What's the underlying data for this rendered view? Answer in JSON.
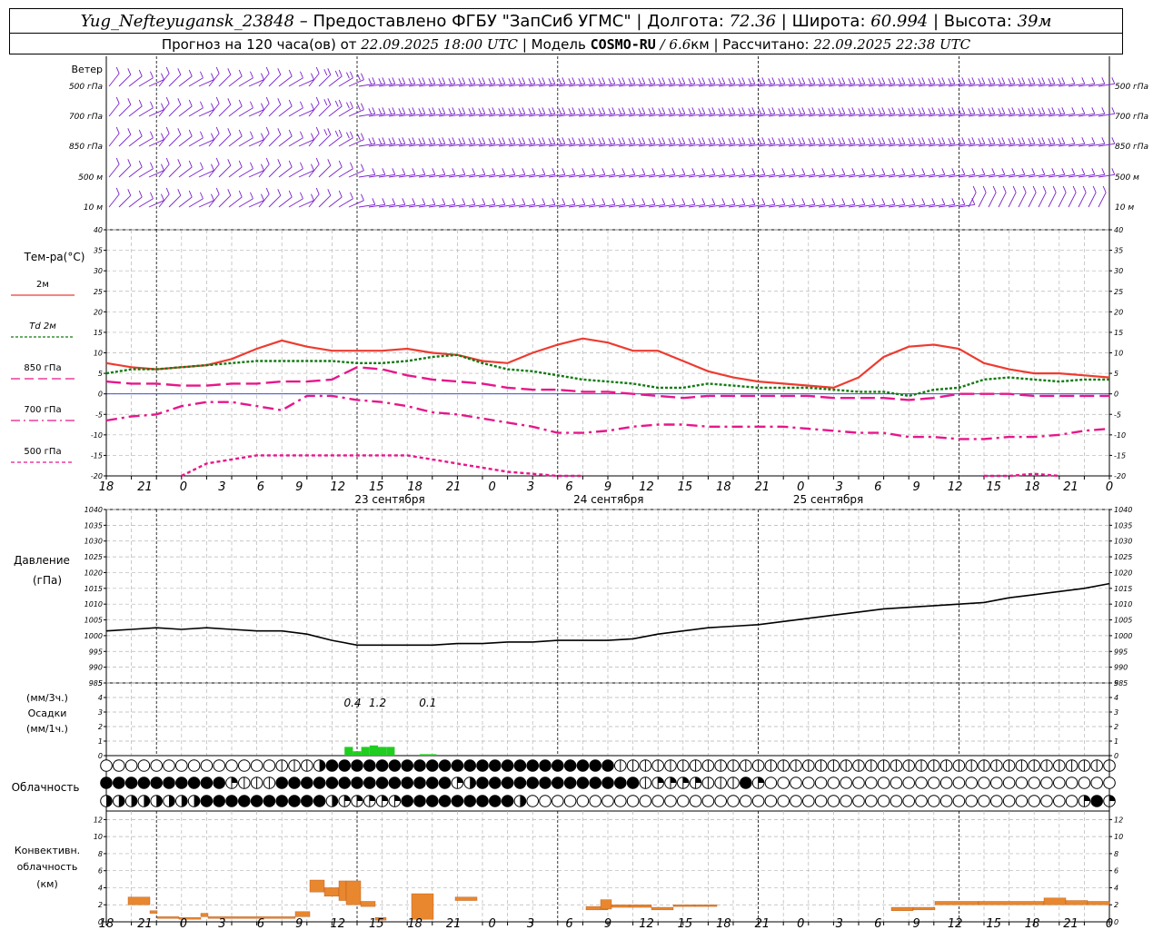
{
  "header": {
    "station": "Yug_Nefteyugansk_23848",
    "provider": "– Предоставлено ФГБУ \"ЗапСиб УГМС\"",
    "lon_label": "Долгота:",
    "lon": "72.36",
    "lat_label": "Широта:",
    "lat": "60.994",
    "alt_label": "Высота:",
    "alt": "39м",
    "forecast_label": "Прогноз на 120 часа(ов) от",
    "forecast_time": "22.09.2025 18:00 UTC",
    "model_label": "Модель",
    "model": "COSMO-RU",
    "resolution": "/ 6.6",
    "resolution_unit": "км",
    "calc_label": "Рассчитано:",
    "calc_time": "22.09.2025 22:38 UTC"
  },
  "labels": {
    "wind_title": "Ветер",
    "wind_levels": [
      "500 гПа",
      "700 гПа",
      "850 гПа",
      "500 м",
      "10  м"
    ],
    "temp_title": "Тем-ра(°C)",
    "temp_legend": [
      "2м",
      "Td  2м",
      "850 гПа",
      "700 гПа",
      "500 гПа"
    ],
    "pressure_title": "Давление",
    "pressure_unit": "(гПа)",
    "precip_unit1": "(мм/3ч.)",
    "precip_title": "Осадки",
    "precip_unit2": "(мм/1ч.)",
    "cloud_title": "Облачность",
    "conv_title1": "Конвективн.",
    "conv_title2": "облачность",
    "conv_unit": "(км)",
    "dates": [
      "23 сентября",
      "24 сентября",
      "25 сентября"
    ]
  },
  "colors": {
    "t2m": "#ee3b30",
    "td2m": "#127a12",
    "t850": "#e6178a",
    "t700": "#e6178a",
    "t500": "#e6178a",
    "wind": "#7a1fcc",
    "pressure": "#000000",
    "precip": "#22cc22",
    "conv": "#e8872e",
    "zero_line": "#2233cc"
  },
  "chart_data": {
    "type": "line",
    "x_hours": [
      0,
      120
    ],
    "x_tick_labels": [
      "18",
      "21",
      "0",
      "3",
      "6",
      "9",
      "12",
      "15",
      "18",
      "21",
      "0",
      "3",
      "6",
      "9",
      "12",
      "15",
      "18",
      "21",
      "0",
      "3",
      "6",
      "9",
      "12",
      "15",
      "18",
      "21",
      "0"
    ],
    "temperature": {
      "ylim": [
        -20,
        40
      ],
      "yticks": [
        -20,
        -15,
        -10,
        -5,
        0,
        5,
        10,
        15,
        20,
        25,
        30,
        35,
        40
      ],
      "series": [
        {
          "name": "2м",
          "key": "t2m",
          "style": "solid",
          "x": [
            0,
            3,
            6,
            9,
            12,
            15,
            18,
            21,
            24,
            27,
            30,
            33,
            36,
            39,
            42,
            45,
            48,
            51,
            54,
            57,
            60,
            63,
            66,
            69,
            72,
            75,
            78,
            81,
            84,
            87,
            90,
            93,
            96,
            99,
            102,
            105,
            108,
            111,
            114,
            117,
            120
          ],
          "y": [
            7.5,
            6.5,
            6,
            6.5,
            7,
            8.5,
            11,
            13,
            11.5,
            10.5,
            10.5,
            10.5,
            11,
            10,
            9.5,
            8,
            7.5,
            10,
            12,
            13.5,
            12.5,
            10.5,
            10.5,
            8,
            5.5,
            4,
            3,
            2.5,
            2,
            1.5,
            4,
            9,
            11.5,
            12,
            11,
            7.5,
            6,
            5,
            5,
            4.5,
            4
          ]
        },
        {
          "name": "Td  2м",
          "key": "td2m",
          "style": "dotted",
          "x": [
            0,
            3,
            6,
            9,
            12,
            15,
            18,
            21,
            24,
            27,
            30,
            33,
            36,
            39,
            42,
            45,
            48,
            51,
            54,
            57,
            60,
            63,
            66,
            69,
            72,
            75,
            78,
            81,
            84,
            87,
            90,
            93,
            96,
            99,
            102,
            105,
            108,
            111,
            114,
            117,
            120
          ],
          "y": [
            5,
            6,
            6,
            6.5,
            7,
            7.5,
            8,
            8,
            8,
            8,
            7.5,
            7.5,
            8,
            9,
            9.5,
            7.5,
            6,
            5.5,
            4.5,
            3.5,
            3,
            2.5,
            1.5,
            1.5,
            2.5,
            2,
            1.5,
            1.5,
            1.5,
            1,
            0.5,
            0.5,
            -0.5,
            1,
            1.5,
            3.5,
            4,
            3.5,
            3,
            3.5,
            3.5
          ]
        },
        {
          "name": "850 гПа",
          "key": "t850",
          "style": "longdash",
          "x": [
            0,
            3,
            6,
            9,
            12,
            15,
            18,
            21,
            24,
            27,
            30,
            33,
            36,
            39,
            42,
            45,
            48,
            51,
            54,
            57,
            60,
            63,
            66,
            69,
            72,
            75,
            78,
            81,
            84,
            87,
            90,
            93,
            96,
            99,
            102,
            105,
            108,
            111,
            114,
            117,
            120
          ],
          "y": [
            3,
            2.5,
            2.5,
            2,
            2,
            2.5,
            2.5,
            3,
            3,
            3.5,
            6.5,
            6,
            4.5,
            3.5,
            3,
            2.5,
            1.5,
            1,
            1,
            0.5,
            0.5,
            0,
            -0.5,
            -1,
            -0.5,
            -0.5,
            -0.5,
            -0.5,
            -0.5,
            -1,
            -1,
            -1,
            -1.5,
            -1,
            0,
            0,
            0,
            -0.5,
            -0.5,
            -0.5,
            -0.5
          ]
        },
        {
          "name": "700 гПа",
          "key": "t700",
          "style": "dashdot",
          "x": [
            0,
            3,
            6,
            9,
            12,
            15,
            18,
            21,
            24,
            27,
            30,
            33,
            36,
            39,
            42,
            45,
            48,
            51,
            54,
            57,
            60,
            63,
            66,
            69,
            72,
            75,
            78,
            81,
            84,
            87,
            90,
            93,
            96,
            99,
            102,
            105,
            108,
            111,
            114,
            117,
            120
          ],
          "y": [
            -6.5,
            -5.5,
            -5,
            -3,
            -2,
            -2,
            -3,
            -4,
            -0.5,
            -0.5,
            -1.5,
            -2,
            -3,
            -4.5,
            -5,
            -6,
            -7,
            -8,
            -9.5,
            -9.5,
            -9,
            -8,
            -7.5,
            -7.5,
            -8,
            -8,
            -8,
            -8,
            -8.5,
            -9,
            -9.5,
            -9.5,
            -10.5,
            -10.5,
            -11,
            -11,
            -10.5,
            -10.5,
            -10,
            -9,
            -8.5
          ]
        },
        {
          "name": "500 гПа",
          "key": "t500",
          "style": "shortdash",
          "x": [
            9,
            12,
            15,
            18,
            21,
            24,
            27,
            30,
            33,
            36,
            39,
            42,
            45,
            48,
            51,
            54,
            57
          ],
          "y": [
            -20,
            -17,
            -16,
            -15,
            -15,
            -15,
            -15,
            -15,
            -15,
            -15,
            -16,
            -17,
            -18,
            -19,
            -19.5,
            -20,
            -20
          ]
        },
        {
          "name": "500 гПа",
          "key": "t500",
          "style": "shortdash",
          "x": [
            105,
            108,
            111,
            114
          ],
          "y": [
            -20,
            -20,
            -19.5,
            -20
          ]
        }
      ]
    },
    "pressure": {
      "ylim": [
        985,
        1040
      ],
      "yticks": [
        985,
        990,
        995,
        1000,
        1005,
        1010,
        1015,
        1020,
        1025,
        1030,
        1035,
        1040
      ],
      "x": [
        0,
        3,
        6,
        9,
        12,
        15,
        18,
        21,
        24,
        27,
        30,
        33,
        36,
        39,
        42,
        45,
        48,
        51,
        54,
        57,
        60,
        63,
        66,
        69,
        72,
        75,
        78,
        81,
        84,
        87,
        90,
        93,
        96,
        99,
        102,
        105,
        108,
        111,
        114,
        117,
        120
      ],
      "y": [
        1001.5,
        1002,
        1002.5,
        1002,
        1002.5,
        1002,
        1001.5,
        1001.5,
        1000.5,
        998.5,
        997,
        997,
        997,
        997,
        997.5,
        997.5,
        998,
        998,
        998.5,
        998.5,
        998.5,
        999,
        1000.5,
        1001.5,
        1002.5,
        1003,
        1003.5,
        1004.5,
        1005.5,
        1006.5,
        1007.5,
        1008.5,
        1009,
        1009.5,
        1010,
        1010.5,
        1012,
        1013,
        1014,
        1015,
        1016.5
      ]
    },
    "precip": {
      "ylim": [
        0,
        5
      ],
      "yticks": [
        0,
        1,
        2,
        3,
        4,
        5
      ],
      "bars": [
        {
          "x": 28.5,
          "w": 1,
          "v": 0.6
        },
        {
          "x": 29.5,
          "w": 1,
          "v": 0.3
        },
        {
          "x": 30.5,
          "w": 1,
          "v": 0.6
        },
        {
          "x": 31.5,
          "w": 1,
          "v": 0.7
        },
        {
          "x": 32.5,
          "w": 1,
          "v": 0.6
        },
        {
          "x": 33.5,
          "w": 1,
          "v": 0.6
        },
        {
          "x": 37.5,
          "w": 1,
          "v": 0.1
        },
        {
          "x": 38.5,
          "w": 1,
          "v": 0.1
        }
      ],
      "totals": [
        {
          "x": 30,
          "label": "0.4"
        },
        {
          "x": 33,
          "label": "1.2"
        },
        {
          "x": 39,
          "label": "0.1"
        }
      ]
    },
    "convective": {
      "ylim": [
        0,
        13
      ],
      "yticks": [
        0,
        2,
        4,
        6,
        8,
        10,
        12
      ],
      "bars": [
        {
          "x0": 3,
          "x1": 6,
          "b": 2,
          "t": 2.9
        },
        {
          "x0": 6,
          "x1": 7,
          "b": 1,
          "t": 1.3
        },
        {
          "x0": 7,
          "x1": 10,
          "b": 0.4,
          "t": 0.6
        },
        {
          "x0": 10,
          "x1": 13,
          "b": 0.3,
          "t": 0.5
        },
        {
          "x0": 13,
          "x1": 14,
          "b": 0.6,
          "t": 1
        },
        {
          "x0": 14,
          "x1": 26,
          "b": 0.4,
          "t": 0.6
        },
        {
          "x0": 26,
          "x1": 28,
          "b": 0.6,
          "t": 1.2
        },
        {
          "x0": 28,
          "x1": 30,
          "b": 3.5,
          "t": 4.9
        },
        {
          "x0": 30,
          "x1": 32,
          "b": 3,
          "t": 4
        },
        {
          "x0": 32,
          "x1": 33,
          "b": 2.5,
          "t": 4.8
        },
        {
          "x0": 33,
          "x1": 35,
          "b": 2,
          "t": 4.8
        },
        {
          "x0": 35,
          "x1": 37,
          "b": 1.8,
          "t": 2.4
        },
        {
          "x0": 37,
          "x1": 38.5,
          "b": 0.2,
          "t": 0.5
        },
        {
          "x0": 42,
          "x1": 45,
          "b": 0.3,
          "t": 3.3
        },
        {
          "x0": 48,
          "x1": 51,
          "b": 2.5,
          "t": 2.9
        },
        {
          "x0": 66,
          "x1": 69,
          "b": 1.4,
          "t": 1.8
        },
        {
          "x0": 68,
          "x1": 69.5,
          "b": 1.5,
          "t": 2.6
        },
        {
          "x0": 69.5,
          "x1": 72,
          "b": 1.7,
          "t": 2
        },
        {
          "x0": 72,
          "x1": 75,
          "b": 1.7,
          "t": 2
        },
        {
          "x0": 75,
          "x1": 78,
          "b": 1.4,
          "t": 1.7
        },
        {
          "x0": 78,
          "x1": 81,
          "b": 1.8,
          "t": 2
        },
        {
          "x0": 81,
          "x1": 84,
          "b": 1.8,
          "t": 2
        },
        {
          "x0": 108,
          "x1": 111,
          "b": 1.3,
          "t": 1.7
        },
        {
          "x0": 111,
          "x1": 114,
          "b": 1.4,
          "t": 1.7
        },
        {
          "x0": 114,
          "x1": 120,
          "b": 2,
          "t": 2.4
        },
        {
          "x0": 120,
          "x1": 129,
          "b": 2,
          "t": 2.4
        },
        {
          "x0": 129,
          "x1": 132,
          "b": 2,
          "t": 2.8
        },
        {
          "x0": 132,
          "x1": 135,
          "b": 2,
          "t": 2.5
        },
        {
          "x0": 135,
          "x1": 138,
          "b": 2,
          "t": 2.4
        }
      ]
    },
    "clouds": {
      "rows": [
        "00000000000000111344444444444444444444444111111111111111111111111111111111111111111111114444444444111111111111111114444444444444444444444",
        "44444444442111444444444444442344444444444441222211142000000000000000000000000000000000000000000000000000000000000000000000000000044444442343344444444444444444444444444",
        "3333333344444444443222224444444443000000000000000000000000000000000000000000002424444443333333333222222222222222222222222222222222233333333334444444444444444444444444"
      ]
    },
    "wind_levels_rows": 5
  }
}
